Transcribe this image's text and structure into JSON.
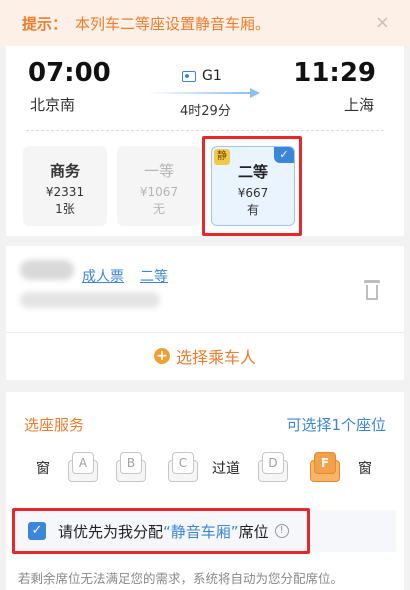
{
  "notice": {
    "label": "提示：",
    "text": "本列车二等座设置静音车厢。",
    "close": "×"
  },
  "trip": {
    "depart_time": "07:00",
    "depart_station": "北京南",
    "arrive_time": "11:29",
    "arrive_station": "上海",
    "train_no": "G1",
    "duration": "4时29分"
  },
  "seats": [
    {
      "name": "商务",
      "price": "¥2331",
      "avail": "1张"
    },
    {
      "name": "一等",
      "price": "¥1067",
      "avail": "无"
    },
    {
      "name": "二等",
      "price": "¥667",
      "avail": "有",
      "tag": "静",
      "selected": true
    }
  ],
  "passenger": {
    "ticket_type": "成人票",
    "seat_class": "二等"
  },
  "select_passenger": {
    "plus": "+",
    "label": "选择乘车人"
  },
  "seat_service": {
    "title": "选座服务",
    "right_text": "可选择1个座位",
    "window_label": "窗",
    "aisle_label": "过道",
    "seat_letters": [
      "A",
      "B",
      "C",
      "D",
      "F"
    ],
    "selected_letter": "F"
  },
  "preference": {
    "checked": "✓",
    "prefix": "请优先为我分配",
    "highlight": "“静音车厢”",
    "suffix": "席位",
    "info": "!"
  },
  "hint": "若剩余席位无法满足您的需求，系统将自动为您分配席位。",
  "colors": {
    "accent": "#3b86d8",
    "orange": "#f07c2e",
    "highlight_box": "#e8272a"
  }
}
